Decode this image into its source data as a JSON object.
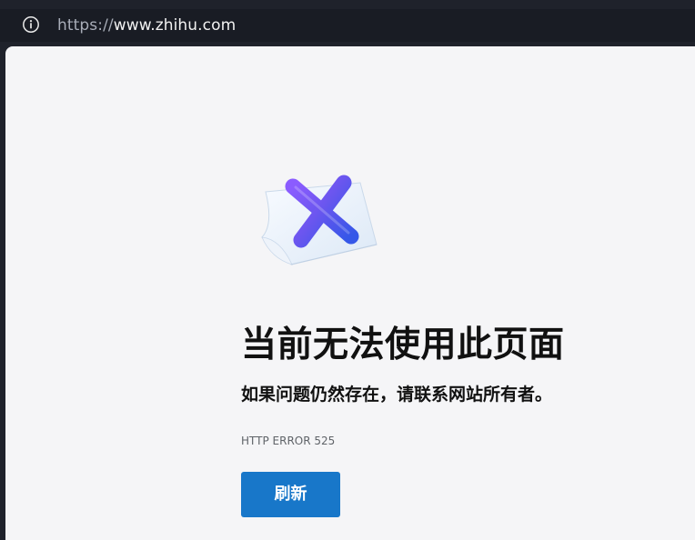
{
  "browser": {
    "address_bar": {
      "url_scheme": "https://",
      "url_host": "www.zhihu.com",
      "info_icon": "info-circle-icon"
    }
  },
  "error_page": {
    "illustration_icon": "close-icon",
    "title": "当前无法使用此页面",
    "subtitle": "如果问题仍然存在，请联系网站所有者。",
    "error_code": "HTTP ERROR 525",
    "refresh_button_label": "刷新"
  },
  "colors": {
    "browser_chrome": "#1f222b",
    "page_background": "#f5f5f7",
    "primary_button": "#1877c9",
    "error_icon_gradient_start": "#7c4dff",
    "error_icon_gradient_end": "#3557e8"
  }
}
